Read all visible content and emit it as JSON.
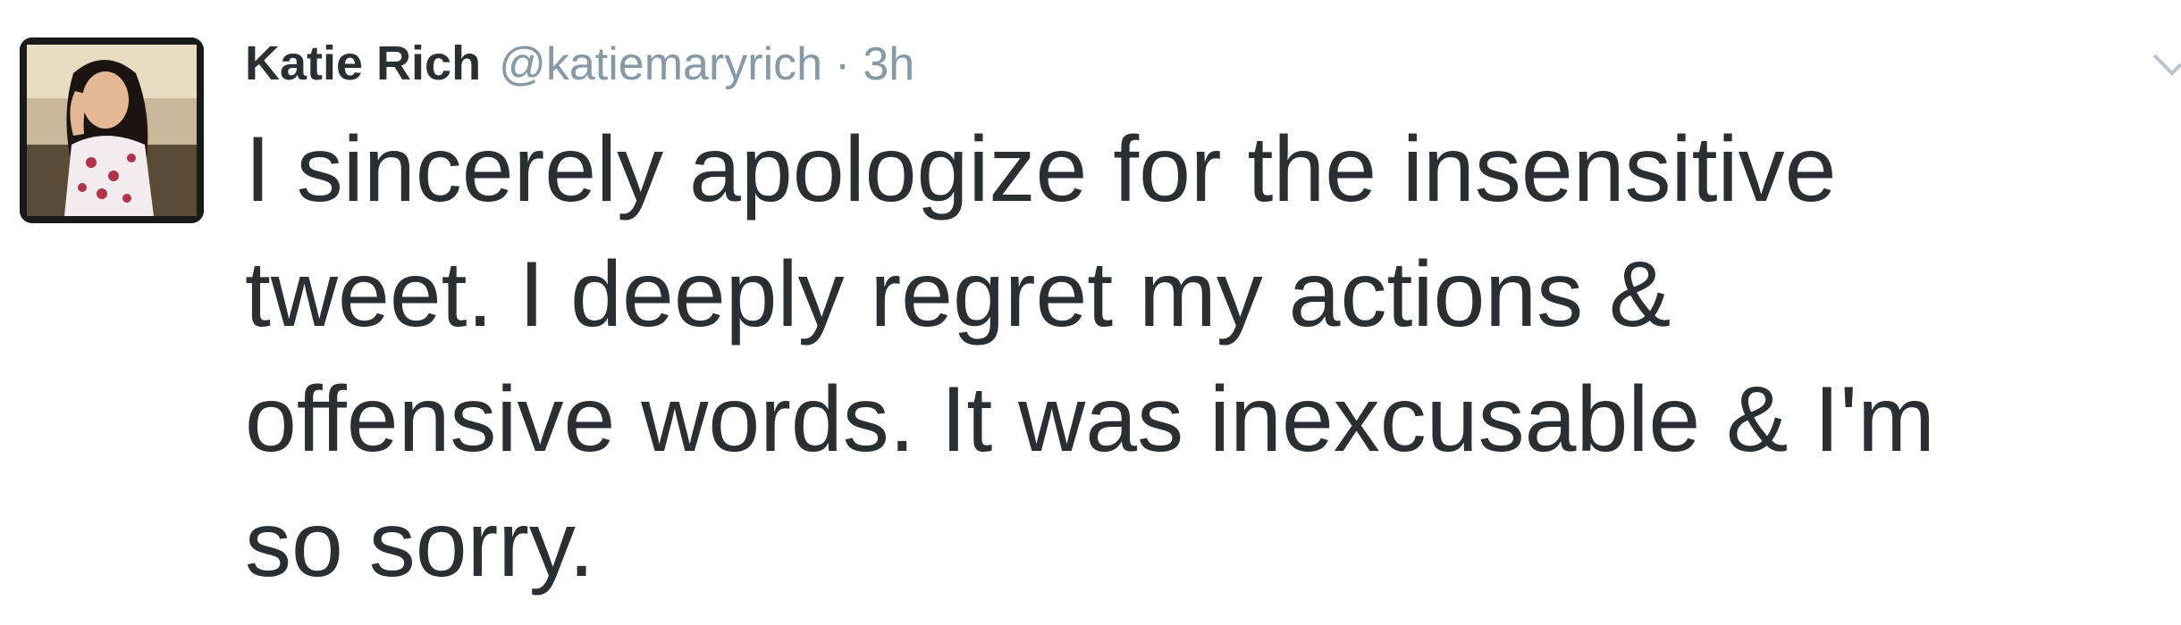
{
  "tweet": {
    "author": {
      "name": "Katie Rich",
      "handle": "@katiemaryrich"
    },
    "separator": "·",
    "time": "3h",
    "text_lines": [
      "I sincerely apologize for the insensitive",
      "tweet. I deeply regret my actions &",
      "offensive words. It was inexcusable & I'm",
      "so sorry."
    ],
    "icons": {
      "avatar": "profile-photo",
      "more": "chevron-down-icon"
    }
  },
  "colors": {
    "text": "#292f33",
    "muted": "#8899a6"
  }
}
